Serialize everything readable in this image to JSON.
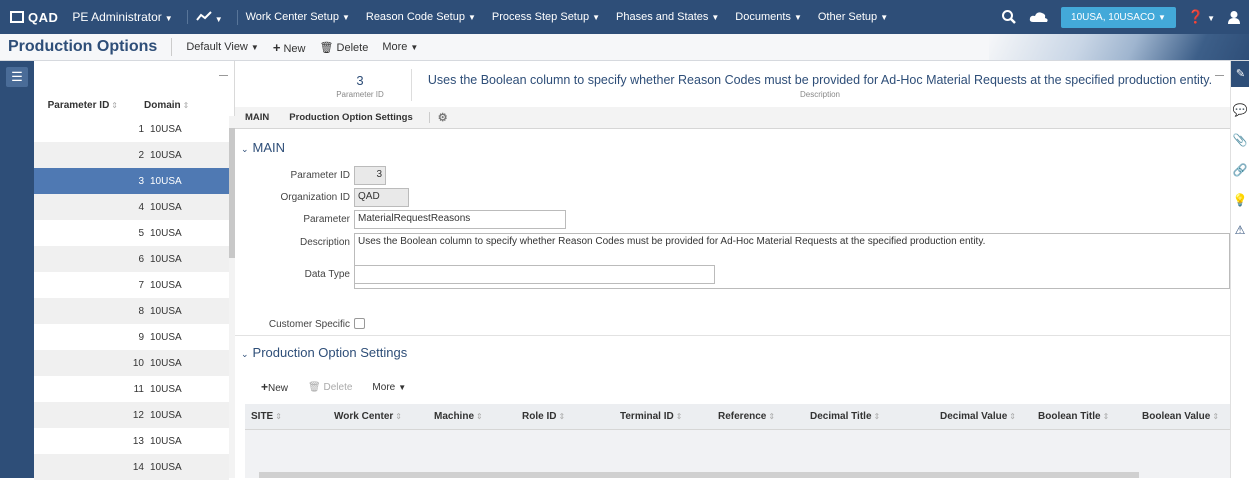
{
  "topbar": {
    "brand": "QAD",
    "role": "PE Administrator",
    "menus": [
      "Work Center Setup",
      "Reason Code Setup",
      "Process Step Setup",
      "Phases and States",
      "Documents",
      "Other Setup"
    ],
    "domain": "10USA, 10USACO",
    "colors": {
      "bar": "#2e4e78",
      "chip": "#43a9d9"
    }
  },
  "subbar": {
    "title": "Production Options",
    "view": "Default View",
    "new_label": "New",
    "delete_label": "Delete",
    "more_label": "More"
  },
  "list": {
    "headers": [
      "Parameter ID",
      "Domain"
    ],
    "rows": [
      {
        "id": "1",
        "domain": "10USA"
      },
      {
        "id": "2",
        "domain": "10USA"
      },
      {
        "id": "3",
        "domain": "10USA"
      },
      {
        "id": "4",
        "domain": "10USA"
      },
      {
        "id": "5",
        "domain": "10USA"
      },
      {
        "id": "6",
        "domain": "10USA"
      },
      {
        "id": "7",
        "domain": "10USA"
      },
      {
        "id": "8",
        "domain": "10USA"
      },
      {
        "id": "9",
        "domain": "10USA"
      },
      {
        "id": "10",
        "domain": "10USA"
      },
      {
        "id": "11",
        "domain": "10USA"
      },
      {
        "id": "12",
        "domain": "10USA"
      },
      {
        "id": "13",
        "domain": "10USA"
      },
      {
        "id": "14",
        "domain": "10USA"
      }
    ],
    "selected_id": "3"
  },
  "header": {
    "param_id": "3",
    "param_id_label": "Parameter ID",
    "description": "Uses the Boolean column to specify whether Reason Codes must be provided for Ad-Hoc Material Requests at the specified production entity.",
    "description_label": "Description"
  },
  "tabs": [
    "MAIN",
    "Production Option Settings"
  ],
  "main": {
    "title": "MAIN",
    "fields": {
      "parameter_id": {
        "label": "Parameter ID",
        "value": "3"
      },
      "organization_id": {
        "label": "Organization ID",
        "value": "QAD"
      },
      "parameter": {
        "label": "Parameter",
        "value": "MaterialRequestReasons"
      },
      "description": {
        "label": "Description",
        "value": "Uses the Boolean column to specify whether Reason Codes must be provided for Ad-Hoc Material Requests at the specified production entity."
      },
      "data_type": {
        "label": "Data Type",
        "value": ""
      },
      "customer_specific": {
        "label": "Customer Specific",
        "checked": false
      }
    }
  },
  "settings": {
    "title": "Production Option Settings",
    "new_label": "New",
    "delete_label": "Delete",
    "more_label": "More",
    "columns": [
      "SITE",
      "Work Center",
      "Machine",
      "Role ID",
      "Terminal ID",
      "Reference",
      "Decimal Title",
      "Decimal Value",
      "Boolean Title",
      "Boolean Value"
    ]
  }
}
